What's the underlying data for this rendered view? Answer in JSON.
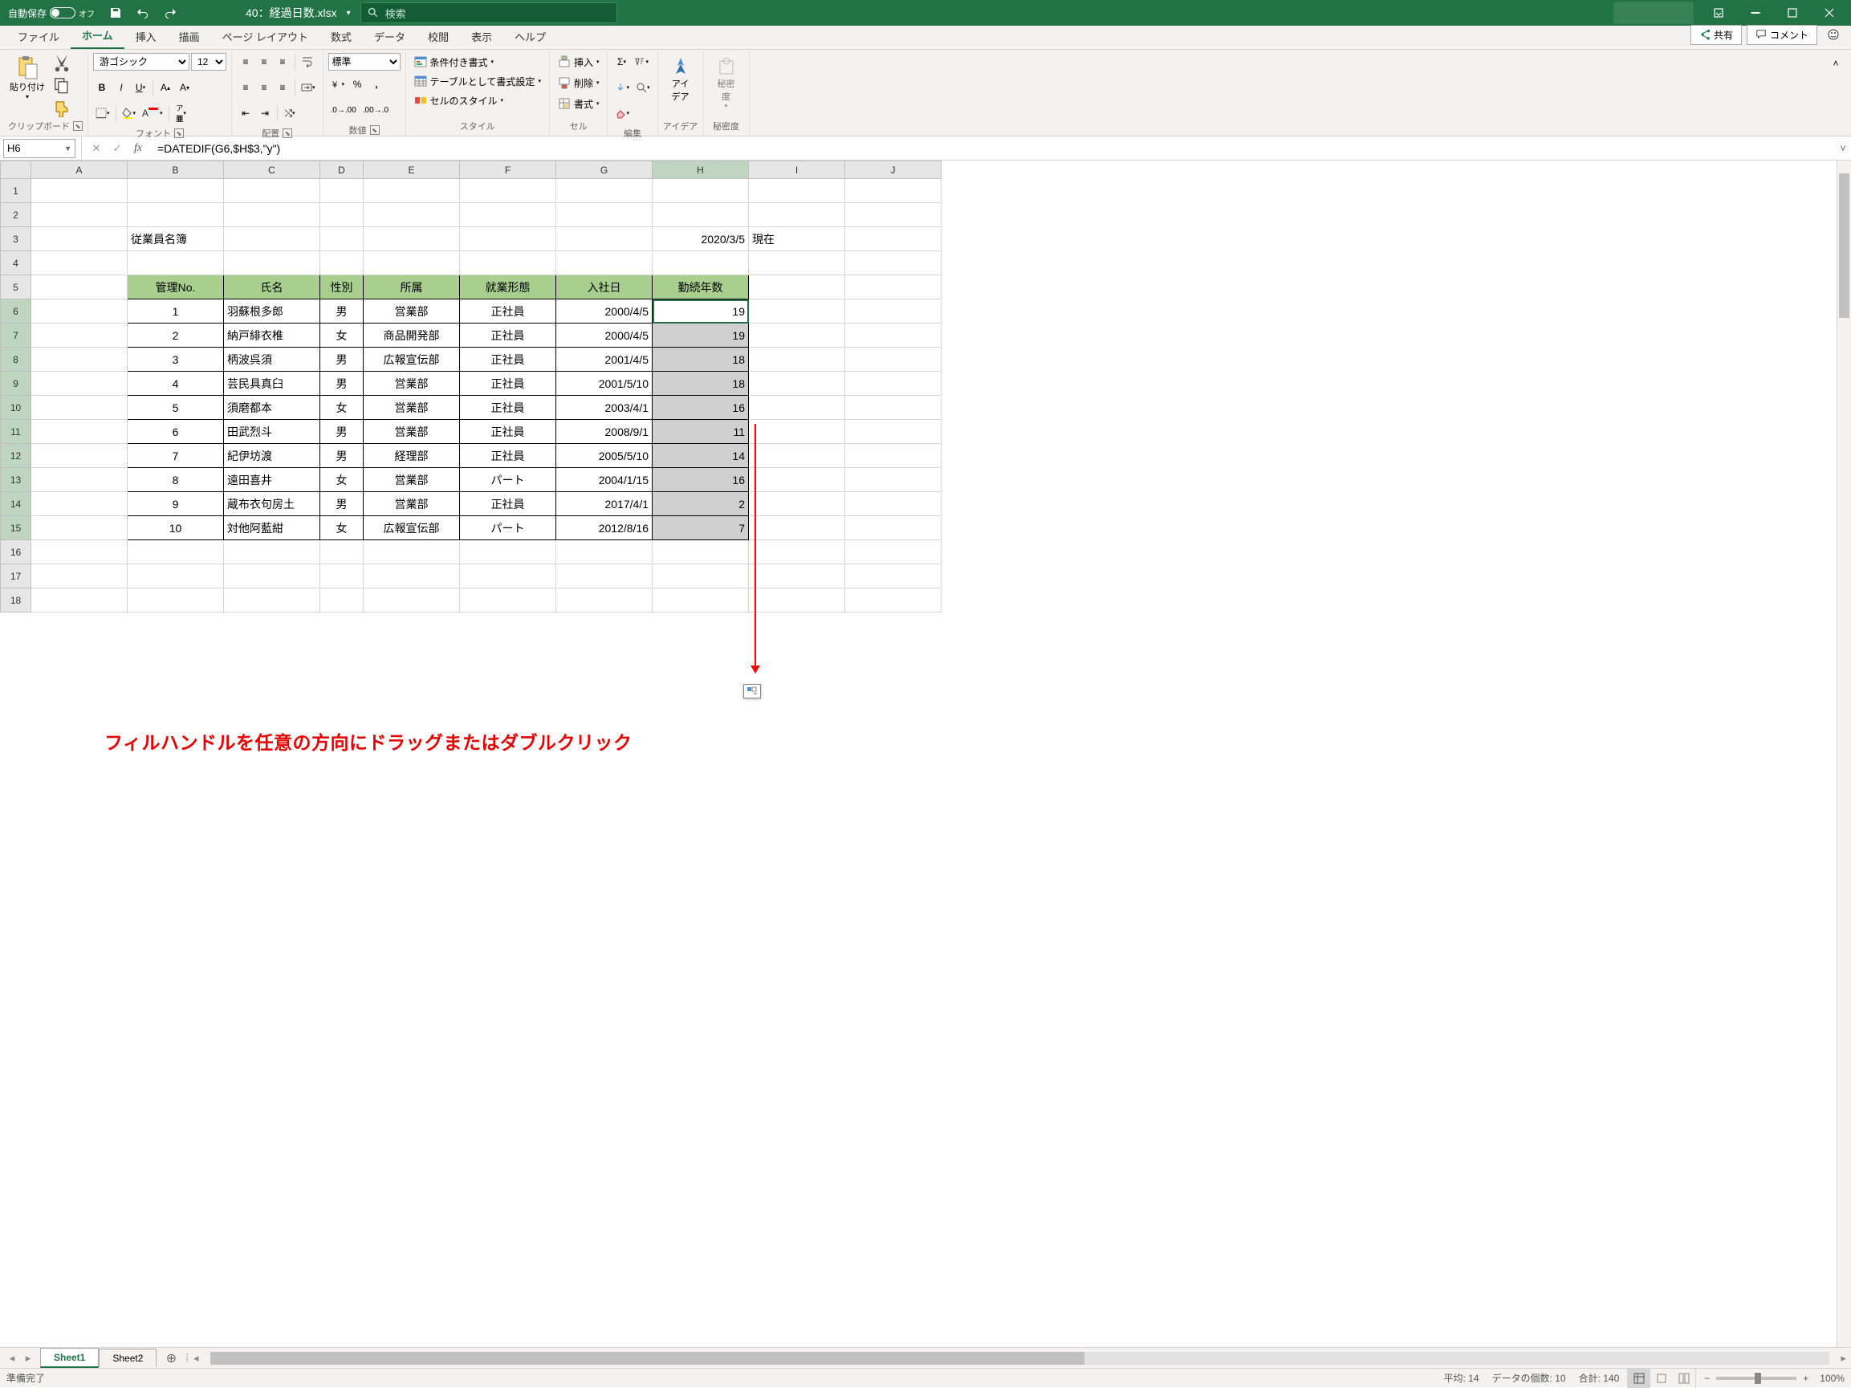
{
  "title": {
    "autosave": "自動保存",
    "autosave_state": "オフ",
    "docname": "40：経過日数.xlsx",
    "search_placeholder": "検索"
  },
  "tabs": {
    "file": "ファイル",
    "home": "ホーム",
    "insert": "挿入",
    "draw": "描画",
    "pagelayout": "ページ レイアウト",
    "formulas": "数式",
    "data": "データ",
    "review": "校閲",
    "view": "表示",
    "help": "ヘルプ",
    "share": "共有",
    "comment": "コメント"
  },
  "ribbon": {
    "clipboard_label": "クリップボード",
    "paste": "貼り付け",
    "font_label": "フォント",
    "font_name": "游ゴシック",
    "font_size": "12",
    "align_label": "配置",
    "number_label": "数値",
    "number_format": "標準",
    "styles_label": "スタイル",
    "cond_fmt": "条件付き書式",
    "as_table": "テーブルとして書式設定",
    "cell_styles": "セルのスタイル",
    "cells_label": "セル",
    "insert": "挿入",
    "delete": "削除",
    "format": "書式",
    "editing_label": "編集",
    "ideas_label": "アイデア",
    "ideas": "アイ\nデア",
    "sensitivity_label": "秘密度",
    "sensitivity": "秘密\n度"
  },
  "namebox": "H6",
  "formula": "=DATEDIF(G6,$H$3,\"y\")",
  "columns": [
    "A",
    "B",
    "C",
    "D",
    "E",
    "F",
    "G",
    "H",
    "I",
    "J"
  ],
  "sheet": {
    "b3": "従業員名簿",
    "h3": "2020/3/5",
    "i3": "現在",
    "headers": {
      "b": "管理No.",
      "c": "氏名",
      "d": "性別",
      "e": "所属",
      "f": "就業形態",
      "g": "入社日",
      "h": "勤続年数"
    },
    "rows": [
      {
        "no": "1",
        "name": "羽蘇根多郎",
        "sex": "男",
        "dept": "営業部",
        "type": "正社員",
        "hire": "2000/4/5",
        "yrs": "19"
      },
      {
        "no": "2",
        "name": "納戸緋衣椎",
        "sex": "女",
        "dept": "商品開発部",
        "type": "正社員",
        "hire": "2000/4/5",
        "yrs": "19"
      },
      {
        "no": "3",
        "name": "柄波呉須",
        "sex": "男",
        "dept": "広報宣伝部",
        "type": "正社員",
        "hire": "2001/4/5",
        "yrs": "18"
      },
      {
        "no": "4",
        "name": "芸民具真臼",
        "sex": "男",
        "dept": "営業部",
        "type": "正社員",
        "hire": "2001/5/10",
        "yrs": "18"
      },
      {
        "no": "5",
        "name": "須磨都本",
        "sex": "女",
        "dept": "営業部",
        "type": "正社員",
        "hire": "2003/4/1",
        "yrs": "16"
      },
      {
        "no": "6",
        "name": "田武烈斗",
        "sex": "男",
        "dept": "営業部",
        "type": "正社員",
        "hire": "2008/9/1",
        "yrs": "11"
      },
      {
        "no": "7",
        "name": "紀伊坊渡",
        "sex": "男",
        "dept": "経理部",
        "type": "正社員",
        "hire": "2005/5/10",
        "yrs": "14"
      },
      {
        "no": "8",
        "name": "遠田喜井",
        "sex": "女",
        "dept": "営業部",
        "type": "パート",
        "hire": "2004/1/15",
        "yrs": "16"
      },
      {
        "no": "9",
        "name": "蔵布衣句房土",
        "sex": "男",
        "dept": "営業部",
        "type": "正社員",
        "hire": "2017/4/1",
        "yrs": "2"
      },
      {
        "no": "10",
        "name": "対他阿藍紺",
        "sex": "女",
        "dept": "広報宣伝部",
        "type": "パート",
        "hire": "2012/8/16",
        "yrs": "7"
      }
    ]
  },
  "sheettabs": {
    "s1": "Sheet1",
    "s2": "Sheet2"
  },
  "status": {
    "ready": "準備完了",
    "avg_lbl": "平均:",
    "avg": "14",
    "cnt_lbl": "データの個数:",
    "cnt": "10",
    "sum_lbl": "合計:",
    "sum": "140",
    "zoom": "100%"
  },
  "annotation": "フィルハンドルを任意の方向にドラッグまたはダブルクリック"
}
